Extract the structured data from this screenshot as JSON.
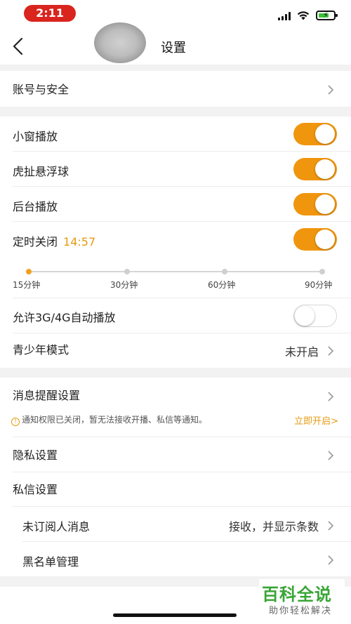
{
  "status_bar": {
    "time": "2:11"
  },
  "nav": {
    "title": "设置"
  },
  "account": {
    "label": "账号与安全"
  },
  "playback": {
    "mini_window": {
      "label": "小窗播放",
      "enabled": true
    },
    "floating_ball": {
      "label": "虎扯悬浮球",
      "enabled": true
    },
    "background": {
      "label": "后台播放",
      "enabled": true
    },
    "timer": {
      "label": "定时关闭",
      "value": "14:57",
      "enabled": true
    },
    "timer_options": [
      "15分钟",
      "30分钟",
      "60分钟",
      "90分钟"
    ],
    "timer_selected": "15分钟",
    "auto_play_3g4g": {
      "label": "允许3G/4G自动播放",
      "enabled": false
    },
    "youth_mode": {
      "label": "青少年模式",
      "value": "未开启"
    }
  },
  "messages": {
    "notify_settings": {
      "label": "消息提醒设置"
    },
    "notice_icon": "!",
    "notice_text": "通知权限已关闭，暂无法接收开播、私信等通知。",
    "notice_action": "立即开启>",
    "privacy": {
      "label": "隐私设置"
    },
    "dm_settings": {
      "label": "私信设置"
    },
    "unsubscribed_msgs": {
      "label": "未订阅人消息",
      "value": "接收，并显示条数"
    },
    "blacklist": {
      "label": "黑名单管理"
    }
  },
  "watermark": {
    "main": "百科全说",
    "sub": "助你轻松解决"
  },
  "colors": {
    "accent": "#f0960e",
    "status_pill": "#d9251d",
    "watermark_green": "#3aa536"
  }
}
